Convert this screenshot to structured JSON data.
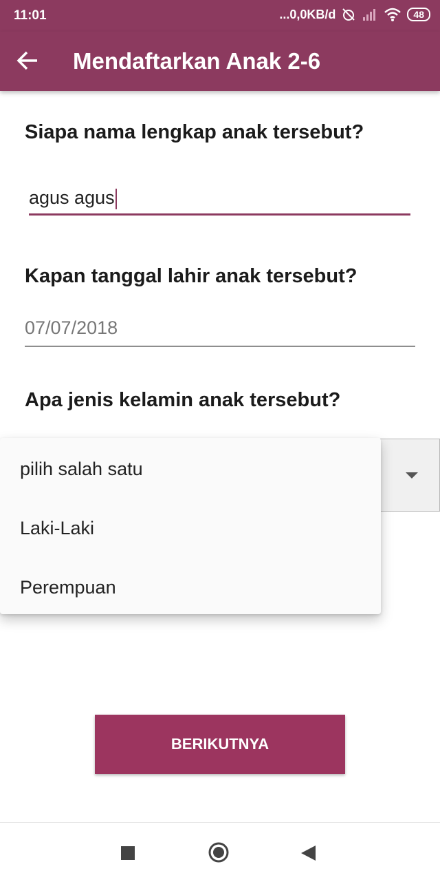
{
  "status_bar": {
    "time": "11:01",
    "network_speed": "...0,0KB/d",
    "battery": "48"
  },
  "app_bar": {
    "title": "Mendaftarkan Anak 2-6",
    "back_icon": "arrow-back-icon"
  },
  "form": {
    "name_question": "Siapa nama lengkap anak tersebut?",
    "name_value": "agus agus",
    "birthdate_question": "Kapan tanggal lahir anak tersebut?",
    "birthdate_value": "07/07/2018",
    "gender_question": "Apa jenis kelamin anak tersebut?",
    "gender_options": [
      "pilih salah satu",
      "Laki-Laki",
      "Perempuan"
    ]
  },
  "actions": {
    "next_label": "BERIKUTNYA"
  },
  "colors": {
    "primary": "#8c3a5f",
    "button": "#9c355f"
  },
  "nav_bar": {
    "icons": [
      "recent-apps-icon",
      "home-icon",
      "back-icon"
    ]
  }
}
